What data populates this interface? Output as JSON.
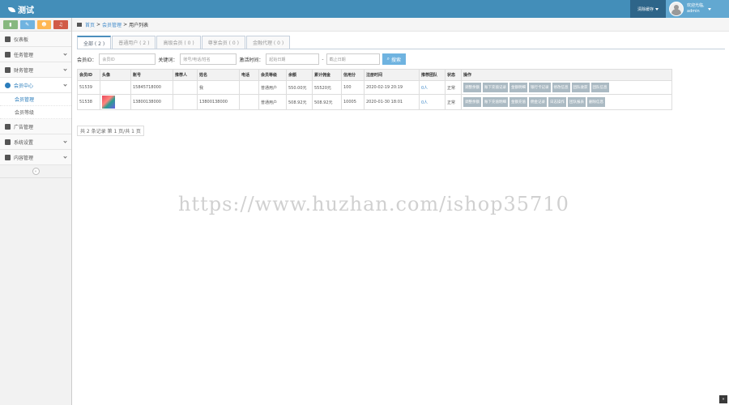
{
  "app": {
    "title": "测试"
  },
  "topbar": {
    "menu_label": "清除缓存",
    "user_greeting": "欢迎光临,",
    "user_name": "admin"
  },
  "sidebar": {
    "items": [
      {
        "label": "仪表板",
        "icon": "tachometer-icon",
        "active": false
      },
      {
        "label": "任务管理",
        "icon": "flag-icon",
        "active": false
      },
      {
        "label": "财务管理",
        "icon": "list-icon",
        "active": false
      },
      {
        "label": "会员中心",
        "icon": "user-icon",
        "active": true
      },
      {
        "label": "广告管理",
        "icon": "picture-icon",
        "active": false
      },
      {
        "label": "系统设置",
        "icon": "gear-icon",
        "active": false
      },
      {
        "label": "内容管理",
        "icon": "book-icon",
        "active": false
      }
    ],
    "subitems": [
      "会员管理",
      "会员等级"
    ]
  },
  "breadcrumb": {
    "home": "首页",
    "section": "会员管理",
    "page": "用户列表",
    "sep": ">"
  },
  "tabs": [
    "全部 ( 2 )",
    "普通用户 ( 2 )",
    "高级会员 ( 0 )",
    "尊享会员 ( 0 )",
    "金融代理 ( 0 )"
  ],
  "search": {
    "id_label": "会员ID：",
    "id_placeholder": "会员ID",
    "keyword_label": "关键词：",
    "keyword_placeholder": "账号/电话/姓名",
    "time_label": "激活时间：",
    "start_placeholder": "起始日期",
    "dash": "-",
    "end_placeholder": "截止日期",
    "button": "搜索"
  },
  "table": {
    "headers": [
      "会员ID",
      "头像",
      "账号",
      "推荐人",
      "姓名",
      "电话",
      "会员等级",
      "余额",
      "累计佣金",
      "信用分",
      "注册时间",
      "推荐团队",
      "状态",
      "操作"
    ],
    "rows": [
      {
        "id": "51539",
        "account": "15845718000",
        "referrer": "",
        "name": "我",
        "phone": "",
        "level": "普通用户",
        "balance": "550.00元",
        "commission": "55520元",
        "credit": "100",
        "reg_time": "2020-02-19 20:19",
        "team": "0人",
        "status": "正常"
      },
      {
        "id": "51538",
        "account": "13800138000",
        "referrer": "",
        "name": "13800138000",
        "phone": "",
        "level": "普通用户",
        "balance": "508.92元",
        "commission": "508.92元",
        "credit": "10005",
        "reg_time": "2020-01-30 18:01",
        "team": "0人",
        "status": "正常"
      }
    ],
    "ops_row1": [
      "调整余额",
      "账下充值记录",
      "金额明细",
      "银行卡记录",
      "修改信息",
      "团队收获",
      "团队信息"
    ],
    "ops_row2": [
      "调整余额",
      "账下充值明细",
      "金额充值",
      "佣金记录",
      "日志操作",
      "团队报表",
      "删除信息"
    ]
  },
  "pager": "共 2 条记录 第 1 页/共 1 页",
  "watermark": "https://www.huzhan.com/ishop35710",
  "colors": {
    "topbar": "#438eb9",
    "accent": "#2b7dbc",
    "op_button": "#abbac3"
  }
}
